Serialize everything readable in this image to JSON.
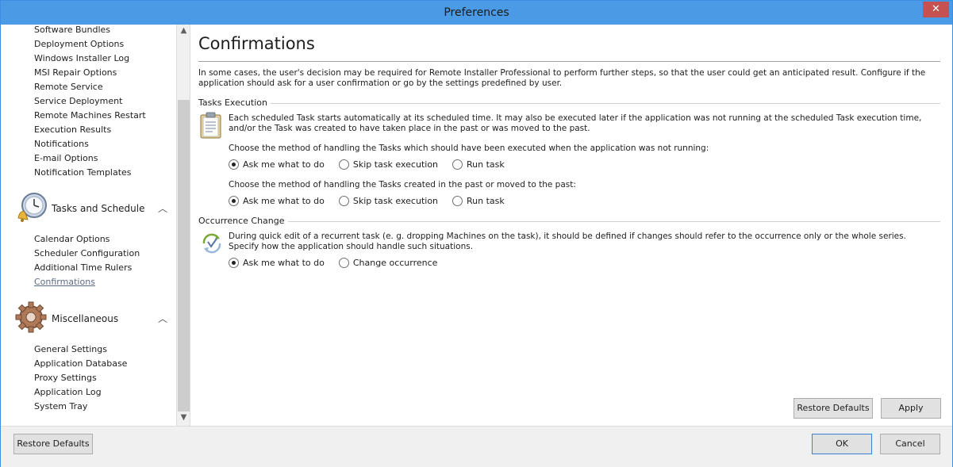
{
  "window": {
    "title": "Preferences",
    "close_glyph": "✕"
  },
  "nav": {
    "top_items": [
      "Software Bundles",
      "Deployment Options",
      "Windows Installer Log",
      "MSI Repair Options",
      "Remote Service",
      "Service Deployment",
      "Remote Machines Restart",
      "Execution Results",
      "Notifications",
      "E-mail Options",
      "Notification Templates"
    ],
    "groups": [
      {
        "label": "Tasks and Schedule",
        "icon": "clock-bell-icon",
        "items": [
          "Calendar Options",
          "Scheduler Configuration",
          "Additional Time Rulers",
          "Confirmations"
        ]
      },
      {
        "label": "Miscellaneous",
        "icon": "gear-icon",
        "items": [
          "General Settings",
          "Application Database",
          "Proxy Settings",
          "Application Log",
          "System Tray"
        ]
      }
    ],
    "active_item": "Confirmations"
  },
  "content": {
    "title": "Confirmations",
    "intro": "In some cases, the user's decision may be required for Remote Installer Professional to perform further steps, so that the user could get an anticipated result. Configure if the application should ask for a user confirmation or go by the settings predefined by user.",
    "tasks_execution": {
      "header": "Tasks Execution",
      "icon": "clipboard-icon",
      "description": "Each scheduled Task starts automatically at its scheduled time. It may also be executed later if the application was not running at the scheduled Task execution time, and/or the Task was created to have taken place in the past or was moved to the past.",
      "q1": {
        "label": "Choose the method of handling the Tasks which should have been executed when the application was not running:",
        "options": [
          "Ask me what to do",
          "Skip task execution",
          "Run task"
        ],
        "selected": "Ask me what to do"
      },
      "q2": {
        "label": "Choose the method of handling the Tasks created in the past or moved to the past:",
        "options": [
          "Ask me what to do",
          "Skip task execution",
          "Run task"
        ],
        "selected": "Ask me what to do"
      }
    },
    "occurrence_change": {
      "header": "Occurrence Change",
      "icon": "recurrence-icon",
      "description": "During quick edit of a recurrent task (e. g. dropping Machines on the task), it should be defined if changes should refer to the occurrence only or the whole series. Specify how the application should handle such situations.",
      "options": [
        "Ask me what to do",
        "Change occurrence"
      ],
      "selected": "Ask me what to do"
    },
    "restore_defaults": "Restore Defaults",
    "apply": "Apply"
  },
  "footer": {
    "restore_defaults": "Restore Defaults",
    "ok": "OK",
    "cancel": "Cancel"
  }
}
